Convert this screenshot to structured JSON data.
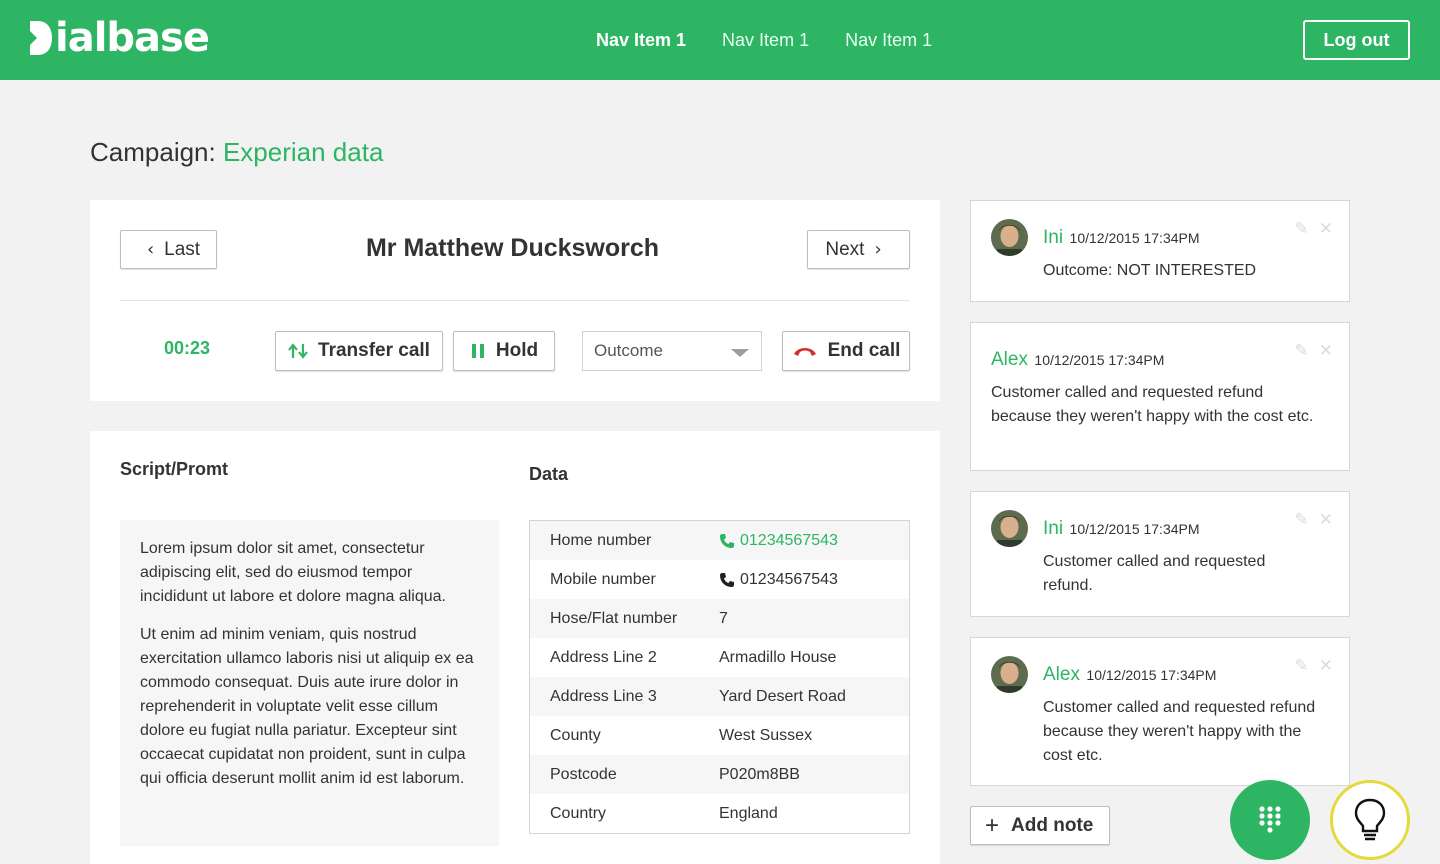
{
  "app": {
    "logo_text": "ialbase",
    "nav": [
      "Nav Item 1",
      "Nav Item 1",
      "Nav Item 1"
    ],
    "logout_label": "Log out"
  },
  "campaign": {
    "label": "Campaign:",
    "name": "Experian data"
  },
  "call": {
    "last_label": "Last",
    "next_label": "Next",
    "contact_name": "Mr Matthew Ducksworch",
    "timer": "00:23",
    "transfer_label": "Transfer call",
    "hold_label": "Hold",
    "outcome_placeholder": "Outcome",
    "end_label": "End call"
  },
  "script": {
    "title": "Script/Promt",
    "paragraphs": [
      "Lorem ipsum dolor sit amet, consectetur adipiscing elit, sed do eiusmod tempor incididunt ut labore et dolore magna aliqua.",
      "Ut enim ad minim veniam, quis nostrud exercitation ullamco laboris nisi ut aliquip ex ea commodo consequat. Duis aute irure dolor in reprehenderit in voluptate velit esse cillum dolore eu fugiat nulla pariatur. Excepteur sint occaecat cupidatat non proident, sunt in culpa qui officia deserunt mollit anim id est laborum."
    ]
  },
  "data": {
    "title": "Data",
    "rows": [
      {
        "label": "Home number",
        "value": "01234567543",
        "phone": true,
        "active": true
      },
      {
        "label": "Mobile number",
        "value": "01234567543",
        "phone": true,
        "active": false
      },
      {
        "label": "Hose/Flat number",
        "value": "7"
      },
      {
        "label": "Address Line 2",
        "value": "Armadillo House"
      },
      {
        "label": "Address Line 3",
        "value": "Yard Desert Road"
      },
      {
        "label": "County",
        "value": "West Sussex"
      },
      {
        "label": "Postcode",
        "value": "P020m8BB"
      },
      {
        "label": "Country",
        "value": "England"
      }
    ]
  },
  "notes": [
    {
      "author": "Ini",
      "time": "10/12/2015 17:34PM",
      "text": "Outcome: NOT INTERESTED"
    },
    {
      "author": "Alex",
      "time": "10/12/2015 17:34PM",
      "text": "Customer called and requested refund because they weren't happy with the cost etc."
    },
    {
      "author": "Ini",
      "time": "10/12/2015 17:34PM",
      "text": "Customer called and requested refund."
    },
    {
      "author": "Alex",
      "time": "10/12/2015 17:34PM",
      "text": "Customer called and requested refund because they weren't happy with the cost etc."
    }
  ],
  "add_note_label": "Add note",
  "icons": {
    "phone": "phone-icon",
    "transfer": "transfer-icon",
    "hold": "pause-icon",
    "end": "hangup-icon",
    "edit": "pencil-icon",
    "close": "close-icon",
    "dialpad": "dialpad-icon",
    "bulb": "lightbulb-icon"
  },
  "colors": {
    "brand": "#2db563",
    "bulb_ring": "#e6d93c",
    "hangup": "#d0312d"
  }
}
